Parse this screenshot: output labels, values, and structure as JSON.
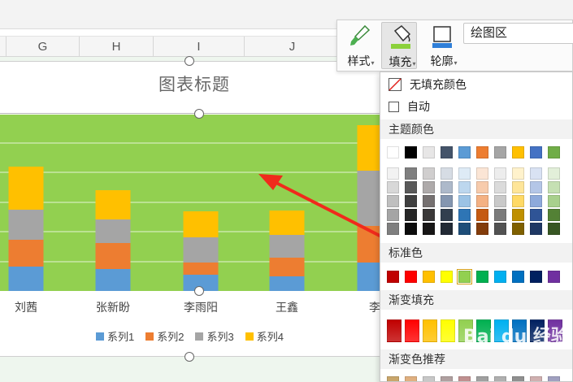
{
  "columns": [
    "G",
    "H",
    "I",
    "J"
  ],
  "chart": {
    "title": "图表标题",
    "plot_color": "#92d050"
  },
  "chart_data": {
    "type": "bar",
    "stacked": true,
    "title": "图表标题",
    "categories": [
      "刘茜",
      "张新盼",
      "李雨阳",
      "王鑫",
      "李"
    ],
    "series": [
      {
        "name": "系列1",
        "color": "#5b9bd5",
        "values": [
          30,
          27,
          20,
          18,
          35
        ]
      },
      {
        "name": "系列2",
        "color": "#ed7d31",
        "values": [
          33,
          32,
          15,
          23,
          45
        ]
      },
      {
        "name": "系列3",
        "color": "#a5a5a5",
        "values": [
          37,
          29,
          31,
          28,
          68
        ]
      },
      {
        "name": "系列4",
        "color": "#ffc000",
        "values": [
          53,
          36,
          32,
          30,
          56
        ]
      }
    ],
    "grid": true,
    "legend": "bottom"
  },
  "ribbon": {
    "style_label": "样式",
    "fill_label": "填充",
    "outline_label": "轮廓",
    "area_value": "绘图区"
  },
  "dropdown": {
    "no_fill": "无填充颜色",
    "auto": "自动",
    "theme_colors": "主题颜色",
    "standard_colors": "标准色",
    "gradient_fill": "渐变填充",
    "gradient_recommend": "渐变色推荐",
    "theme_top": [
      "#ffffff",
      "#000000",
      "#e7e6e6",
      "#44546a",
      "#5b9bd5",
      "#ed7d31",
      "#a5a5a5",
      "#ffc000",
      "#4472c4",
      "#70ad47"
    ],
    "theme_shades": [
      [
        "#f2f2f2",
        "#7f7f7f",
        "#d0cece",
        "#d6dce4",
        "#deebf6",
        "#fbe5d5",
        "#ededed",
        "#fff2cc",
        "#d9e2f3",
        "#e2efd9"
      ],
      [
        "#d8d8d8",
        "#595959",
        "#aeaaaa",
        "#adb9ca",
        "#bdd7ee",
        "#f7cbac",
        "#dbdbdb",
        "#fee599",
        "#b4c6e7",
        "#c5e0b3"
      ],
      [
        "#bfbfbf",
        "#3f3f3f",
        "#757070",
        "#8496b0",
        "#9cc3e5",
        "#f4b183",
        "#c9c9c9",
        "#ffd965",
        "#8eaadb",
        "#a8d08d"
      ],
      [
        "#a5a5a5",
        "#262626",
        "#3a3838",
        "#323f4f",
        "#2e75b5",
        "#c55a11",
        "#7b7b7b",
        "#bf9000",
        "#2f5496",
        "#538135"
      ],
      [
        "#7f7f7f",
        "#0c0c0c",
        "#171616",
        "#222a35",
        "#1e4e79",
        "#833c0b",
        "#525252",
        "#7f6000",
        "#1f3864",
        "#375623"
      ]
    ],
    "standard": [
      "#c00000",
      "#ff0000",
      "#ffc000",
      "#ffff00",
      "#92d050",
      "#00b050",
      "#00b0f0",
      "#0070c0",
      "#002060",
      "#7030a0"
    ],
    "gradient": [
      "#c00000",
      "#ff0000",
      "#ffc000",
      "#ffff00",
      "#92d050",
      "#00b050",
      "#00b0f0",
      "#0070c0",
      "#002060",
      "#7030a0"
    ],
    "recommend": [
      "#c9a66b",
      "#e0b080",
      "#c8c8c8",
      "#b0a0a0",
      "#c09090",
      "#a0a0a0",
      "#b0b0b0",
      "#909090",
      "#d0b0b0",
      "#a0a0c0"
    ]
  },
  "watermark": "Bai du 经验"
}
